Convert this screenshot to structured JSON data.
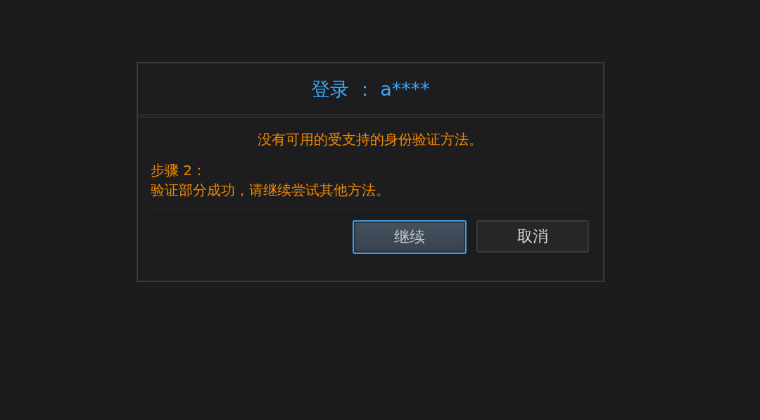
{
  "dialog": {
    "title": "登录 ： a****",
    "message": "没有可用的受支持的身份验证方法。",
    "step_label": "步骤 2：",
    "step_text": "验证部分成功，请继续尝试其他方法。",
    "buttons": [
      {
        "label": "继续",
        "focused": true
      },
      {
        "label": "取消",
        "focused": false
      }
    ]
  }
}
